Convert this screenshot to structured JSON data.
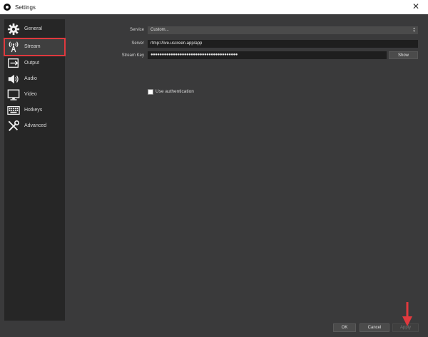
{
  "window": {
    "title": "Settings",
    "close_glyph": "✕"
  },
  "sidebar": {
    "items": [
      {
        "label": "General",
        "icon": "gear-icon"
      },
      {
        "label": "Stream",
        "icon": "broadcast-antenna-icon"
      },
      {
        "label": "Output",
        "icon": "output-icon"
      },
      {
        "label": "Audio",
        "icon": "speaker-icon"
      },
      {
        "label": "Video",
        "icon": "monitor-icon"
      },
      {
        "label": "Hotkeys",
        "icon": "keyboard-icon"
      },
      {
        "label": "Advanced",
        "icon": "wrench-screwdriver-icon"
      }
    ],
    "active_index": 1
  },
  "stream": {
    "service_label": "Service",
    "service_value": "Custom...",
    "server_label": "Server",
    "server_value": "rtmp://live.uscreen.app/app",
    "stream_key_label": "Stream Key",
    "stream_key_value": "●●●●●●●●●●●●●●●●●●●●●●●●●●●●●●●●●●●●●●●",
    "show_label": "Show",
    "use_auth_label": "Use authentication",
    "use_auth_checked": false
  },
  "footer": {
    "ok_label": "OK",
    "cancel_label": "Cancel",
    "apply_label": "Apply"
  },
  "colors": {
    "highlight_red": "#e0393e",
    "window_bg": "#3a3a3b",
    "sidebar_bg": "#262626"
  }
}
